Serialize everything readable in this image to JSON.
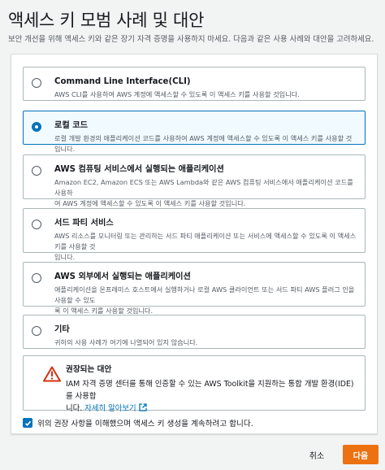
{
  "page": {
    "title": "액세스 키 모범 사례 및 대안",
    "subtitle": "보안 개선을 위해 액세스 키와 같은 장기 자격 증명을 사용하지 마세요. 다음과 같은 사용 사례와 대안을 고려하세요."
  },
  "options": [
    {
      "title": "Command Line Interface(CLI)",
      "desc": "AWS CLI를 사용하여 AWS 계정에 액세스할 수 있도록 이 액세스 키를 사용할 것입니다.",
      "selected": false
    },
    {
      "title": "로컬 코드",
      "desc": "로컬 개발 환경의 애플리케이션 코드를 사용하여 AWS 계정에 액세스할 수 있도록 이 액세스 키를 사용할 것입니다.",
      "selected": true
    },
    {
      "title": "AWS 컴퓨팅 서비스에서 실행되는 애플리케이션",
      "desc_line1": "Amazon EC2, Amazon ECS 또는 AWS Lambda와 같은 AWS 컴퓨팅 서비스에서 애플리케이션 코드를 사용하",
      "desc_line2": "여 AWS 계정에 액세스할 수 있도록 이 액세스 키를 사용할 것입니다.",
      "selected": false
    },
    {
      "title": "서드 파티 서비스",
      "desc_line1": "AWS 리소스를 모니터링 또는 관리하는 서드 파티 애플리케이션 또는 서비스에 액세스할 수 있도록 이 액세스 키를 사용할 것",
      "desc_line2": "입니다.",
      "selected": false
    },
    {
      "title": "AWS 외부에서 실행되는 애플리케이션",
      "desc_line1": "애플리케이션을 온프레미스 호스트에서 실행하거나 로컬 AWS 클라이언트 또는 서드 파티 AWS 플러그 인을 사용할 수 있도",
      "desc_line2": "록 이 액세스 키를 사용할 것입니다.",
      "selected": false
    },
    {
      "title": "기타",
      "desc": "귀하의 사용 사례가 여기에 나열되어 있지 않습니다.",
      "selected": false
    }
  ],
  "alert": {
    "title": "권장되는 대안",
    "body_line1": "IAM 자격 증명 센터를 통해 인증할 수 있는 AWS Toolkit을 지원하는 통합 개발 환경(IDE)를 사용합",
    "body_line2_prefix": "니다. ",
    "link": "자세히 알아보기"
  },
  "confirm": {
    "label": "위의 권장 사항을 이해했으며 액세스 키 생성을 계속하려고 합니다.",
    "checked": true
  },
  "footer": {
    "cancel_label": "취소",
    "next_label": "다음"
  },
  "colors": {
    "accent": "#0073bb",
    "primary_button": "#ec7211",
    "warning": "#d13212"
  }
}
